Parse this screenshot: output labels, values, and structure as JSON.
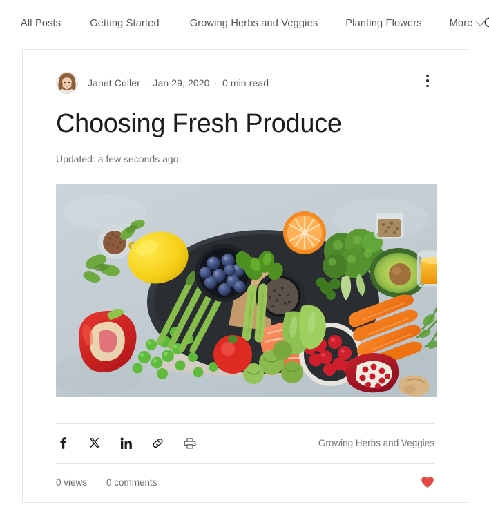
{
  "nav": {
    "items": [
      {
        "label": "All Posts",
        "name": "nav-all-posts"
      },
      {
        "label": "Getting Started",
        "name": "nav-getting-started"
      },
      {
        "label": "Growing Herbs and Veggies",
        "name": "nav-growing-herbs-and-veggies"
      },
      {
        "label": "Planting Flowers",
        "name": "nav-planting-flowers"
      },
      {
        "label": "More",
        "name": "nav-more"
      }
    ],
    "more_label": "More",
    "search_icon": "search-icon",
    "chevron_icon": "chevron-down-icon"
  },
  "post": {
    "author": {
      "name": "Janet Coller",
      "avatar_icon": "avatar-photo"
    },
    "date": "Jan 29, 2020",
    "read_time": "0 min read",
    "separator": "·",
    "title": "Choosing Fresh Produce",
    "updated": "Updated: a few seconds ago",
    "options_icon": "more-options-icon",
    "hero_image": {
      "name": "hero-image",
      "alt": "Assorted fresh produce flat lay: salmon, blueberries, broccoli, carrots, avocado, lemon, pomegranate, red bell pepper, asparagus, peas, cranberries, chia seeds, flax seeds, orange and honey on a light blue-gray surface",
      "background": "#c5cfd4"
    }
  },
  "share": {
    "icons": [
      {
        "name": "facebook-share-icon",
        "label": "Facebook"
      },
      {
        "name": "x-share-icon",
        "label": "X"
      },
      {
        "name": "linkedin-share-icon",
        "label": "LinkedIn"
      },
      {
        "name": "copy-link-icon",
        "label": "Copy link"
      },
      {
        "name": "print-icon",
        "label": "Print"
      }
    ],
    "category_label": "Growing Herbs and Veggies"
  },
  "footer": {
    "views": "0 views",
    "comments": "0 comments",
    "like_icon": "heart-filled-icon",
    "like_color": "#e34a45"
  },
  "colors": {
    "accent_like": "#e34a45",
    "card_border": "#e8e8e8",
    "divider": "#e4e4e4",
    "text_primary": "#1c1c1c",
    "text_muted": "#6f6f6f",
    "background": "#ffffff"
  }
}
